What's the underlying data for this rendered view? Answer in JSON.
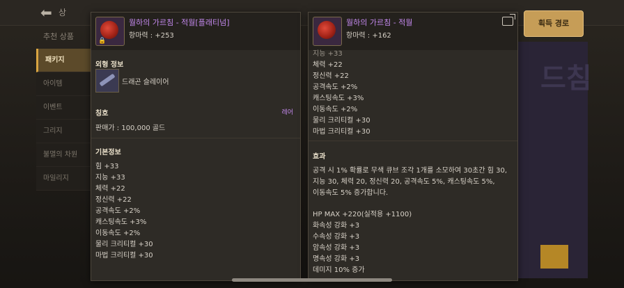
{
  "background": {
    "title": "상",
    "subtab": "추천 상품",
    "sidebar": [
      "패키지",
      "아이템",
      "이벤트",
      "그리지",
      "불멸의 차원",
      "마일리지"
    ],
    "active_index": 0,
    "right_text": "드침"
  },
  "left_panel": {
    "name": "월하의 가르침 - 적월[플래티넘]",
    "attack": "항마력 : +253",
    "appearance_title": "외형 정보",
    "appearance_name": "드래곤 슬레이어",
    "title_section": "칭호",
    "rarity": "레어",
    "price": "판매가 : 100,000 골드",
    "basic_title": "기본정보",
    "stats": [
      "힘 +33",
      "지능 +33",
      "체력 +22",
      "정신력 +22",
      "공격속도 +2%",
      "캐스팅속도 +3%",
      "이동속도 +2%",
      "물리 크리티컬 +30",
      "마법 크리티컬 +30"
    ]
  },
  "right_panel": {
    "name": "월하의 가르침 - 적월",
    "attack": "항마력 : +162",
    "stats": [
      "지능 +33",
      "체력 +22",
      "정신력 +22",
      "공격속도 +2%",
      "캐스팅속도 +3%",
      "이동속도 +2%",
      "물리 크리티컬 +30",
      "마법 크리티컬 +30"
    ],
    "effect_title": "효과",
    "effect_lines": [
      "공격 시 1% 확률로 무색 큐브 조각 1개를 소모하여 30초간 힘 30,",
      "지능 30, 체력 20, 정신력 20, 공격속도 5%, 캐스팅속도 5%,",
      "이동속도 5% 증가합니다."
    ],
    "extra": [
      "HP MAX +220(실적용 +1100)",
      "화속성 강화 +3",
      "수속성 강화 +3",
      "암속성 강화 +3",
      "명속성 강화 +3",
      "데미지 10% 증가"
    ]
  },
  "acquire_button": "획득 경로",
  "colors": {
    "item_name": "#c489ee",
    "button": "#c69d57"
  }
}
